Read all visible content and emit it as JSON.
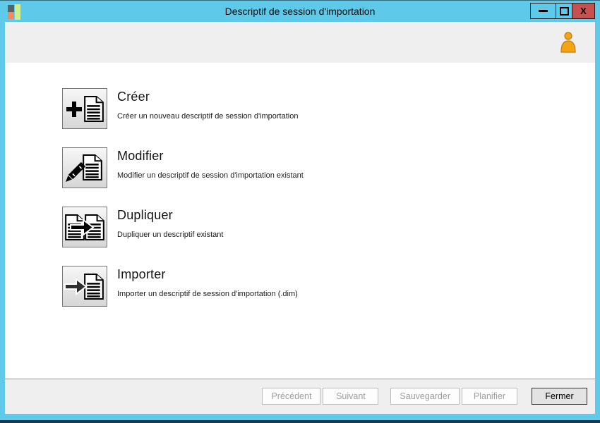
{
  "window": {
    "title": "Descriptif de session d'importation",
    "controls": {
      "close": "X"
    }
  },
  "actions": [
    {
      "title": "Créer",
      "description": "Créer un nouveau descriptif de session d'importation",
      "icon": "new-document-icon"
    },
    {
      "title": "Modifier",
      "description": "Modifier un descriptif de session d'importation existant",
      "icon": "edit-document-icon"
    },
    {
      "title": "Dupliquer",
      "description": "Dupliquer un descriptif existant",
      "icon": "duplicate-document-icon"
    },
    {
      "title": "Importer",
      "description": "Importer un descriptif de session d'importation (.dim)",
      "icon": "import-document-icon"
    }
  ],
  "footer": {
    "buttons": [
      {
        "label": "Précédent",
        "enabled": false
      },
      {
        "label": "Suivant",
        "enabled": false
      },
      {
        "label": "Sauvegarder",
        "enabled": false
      },
      {
        "label": "Planifier",
        "enabled": false
      },
      {
        "label": "Fermer",
        "enabled": true
      }
    ]
  },
  "colors": {
    "titlebar": "#5ec9e8",
    "close_button": "#c75050",
    "panel_gray": "#efefef",
    "bottom_edge_navy": "#15394e",
    "user_icon_orange": "#f3a413"
  }
}
